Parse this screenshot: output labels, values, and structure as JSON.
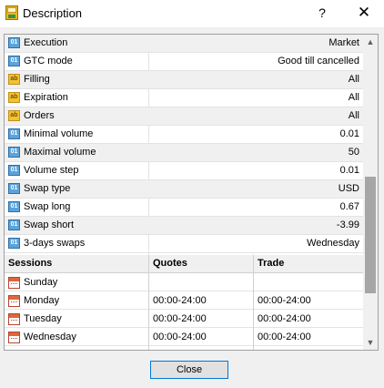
{
  "window": {
    "title": "Description",
    "help_label": "?",
    "close_label": "✕"
  },
  "properties": [
    {
      "icon": "numeric-icon",
      "icon_text": "01",
      "name": "Execution",
      "value": "Market"
    },
    {
      "icon": "numeric-icon",
      "icon_text": "01",
      "name": "GTC mode",
      "value": "Good till cancelled"
    },
    {
      "icon": "text-icon",
      "icon_text": "ab",
      "name": "Filling",
      "value": "All"
    },
    {
      "icon": "text-icon",
      "icon_text": "ab",
      "name": "Expiration",
      "value": "All"
    },
    {
      "icon": "text-icon",
      "icon_text": "ab",
      "name": "Orders",
      "value": "All"
    },
    {
      "icon": "numeric-icon",
      "icon_text": "01",
      "name": "Minimal volume",
      "value": "0.01"
    },
    {
      "icon": "numeric-icon",
      "icon_text": "01",
      "name": "Maximal volume",
      "value": "50"
    },
    {
      "icon": "numeric-icon",
      "icon_text": "01",
      "name": "Volume step",
      "value": "0.01"
    },
    {
      "icon": "numeric-icon",
      "icon_text": "01",
      "name": "Swap type",
      "value": "USD"
    },
    {
      "icon": "numeric-icon",
      "icon_text": "01",
      "name": "Swap long",
      "value": "0.67"
    },
    {
      "icon": "numeric-icon",
      "icon_text": "01",
      "name": "Swap short",
      "value": "-3.99"
    },
    {
      "icon": "numeric-icon",
      "icon_text": "01",
      "name": "3-days swaps",
      "value": "Wednesday"
    }
  ],
  "sessions": {
    "headers": {
      "sessions": "Sessions",
      "quotes": "Quotes",
      "trade": "Trade"
    },
    "rows": [
      {
        "day": "Sunday",
        "quotes": "",
        "trade": ""
      },
      {
        "day": "Monday",
        "quotes": "00:00-24:00",
        "trade": "00:00-24:00"
      },
      {
        "day": "Tuesday",
        "quotes": "00:00-24:00",
        "trade": "00:00-24:00"
      },
      {
        "day": "Wednesday",
        "quotes": "00:00-24:00",
        "trade": "00:00-24:00"
      }
    ]
  },
  "scrollbar": {
    "up_arrow": "▲",
    "down_arrow": "▼",
    "position": 0.75
  },
  "footer": {
    "close_label": "Close"
  },
  "colors": {
    "numeric_icon": "#5ba3d9",
    "text_icon": "#f2c233",
    "button_focus_border": "#0078d7"
  }
}
